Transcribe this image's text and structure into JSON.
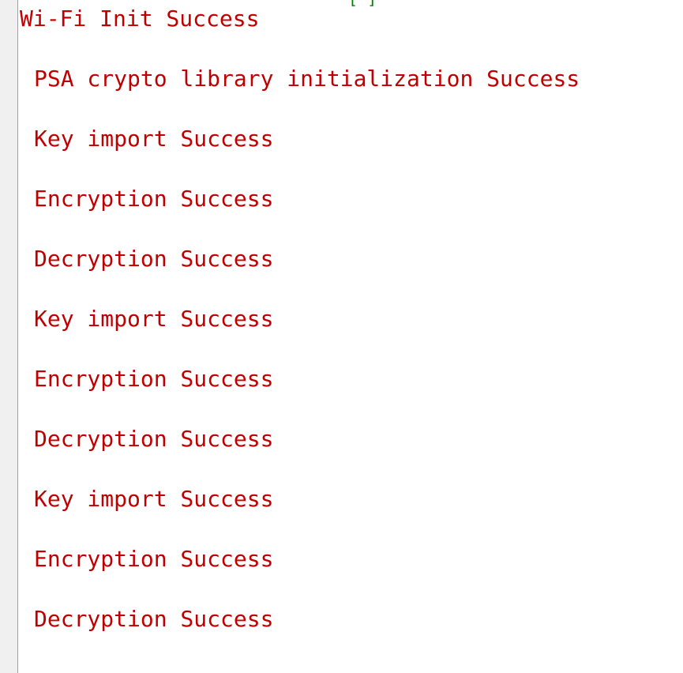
{
  "console": {
    "top_fragment": "[ ]",
    "lines": [
      "Wi-Fi Init Success",
      "PSA crypto library initialization Success",
      "Key import Success",
      "Encryption Success",
      "Decryption Success",
      "Key import Success",
      "Encryption Success",
      "Decryption Success",
      "Key import Success",
      "Encryption Success",
      "Decryption Success"
    ]
  },
  "colors": {
    "text": "#c00000",
    "fragment": "#008000",
    "gutter": "#f0f0f0",
    "background": "#ffffff"
  }
}
